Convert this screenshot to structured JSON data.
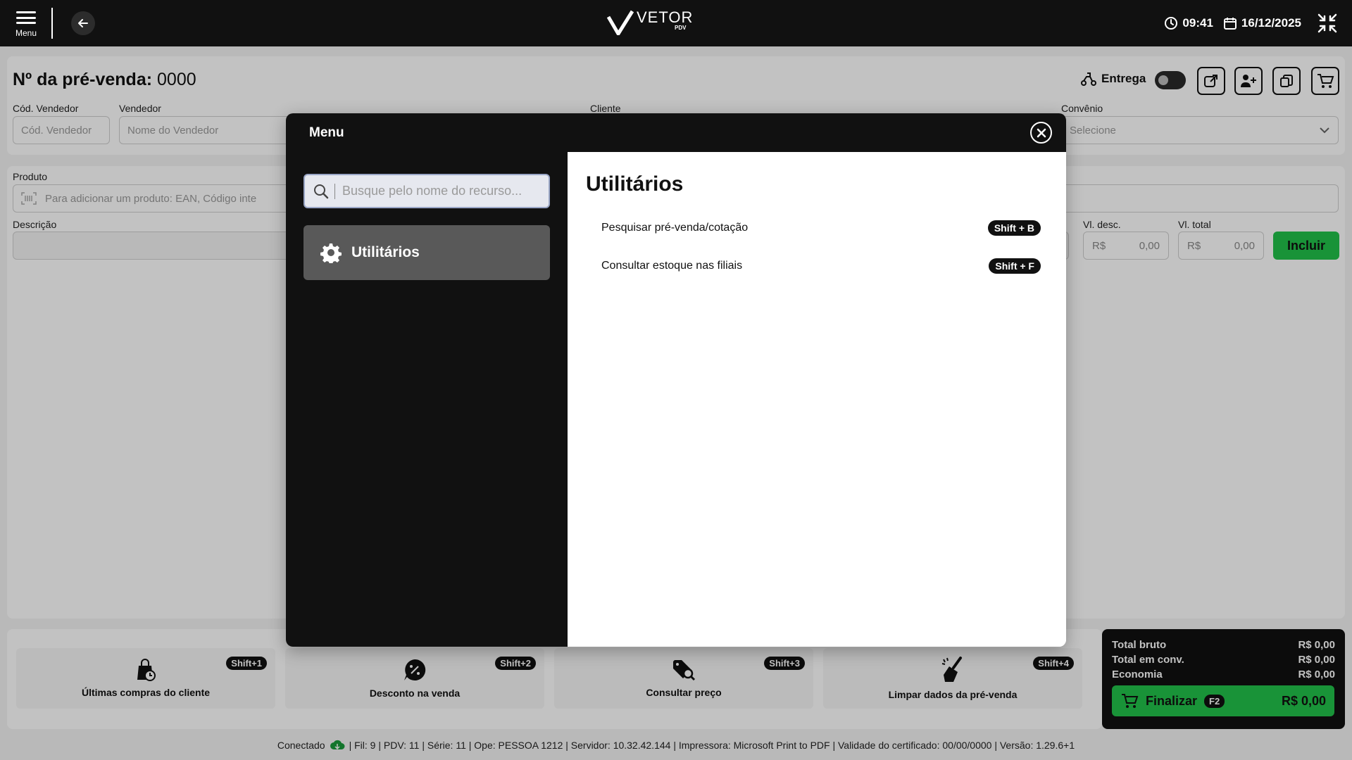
{
  "topbar": {
    "menu_label": "Menu",
    "logo_main": "VETOR",
    "logo_sub": "PDV",
    "time": "09:41",
    "date": "16/12/2025"
  },
  "presale": {
    "title": "Nº da pré-venda:",
    "number": "0000",
    "entrega_label": "Entrega"
  },
  "form": {
    "cod_vendedor_label": "Cód. Vendedor",
    "cod_vendedor_placeholder": "Cód. Vendedor",
    "vendedor_label": "Vendedor",
    "vendedor_placeholder": "Nome do Vendedor",
    "cliente_label": "Cliente",
    "convenio_label": "Convênio",
    "convenio_placeholder": "Selecione",
    "produto_label": "Produto",
    "produto_placeholder": "Para adicionar um produto: EAN, Código inte",
    "descricao_label": "Descrição",
    "vl_desc_label": "Vl. desc.",
    "vl_total_label": "Vl. total",
    "currency": "R$",
    "zero": "0,00",
    "incluir": "Incluir"
  },
  "shortcuts": [
    {
      "label": "Últimas compras do cliente",
      "key": "Shift+1"
    },
    {
      "label": "Desconto na venda",
      "key": "Shift+2"
    },
    {
      "label": "Consultar preço",
      "key": "Shift+3"
    },
    {
      "label": "Limpar dados da pré-venda",
      "key": "Shift+4"
    }
  ],
  "totals": {
    "bruto_label": "Total bruto",
    "bruto_value": "R$ 0,00",
    "conv_label": "Total em conv.",
    "conv_value": "R$ 0,00",
    "economia_label": "Economia",
    "economia_value": "R$ 0,00",
    "finalizar_label": "Finalizar",
    "finalizar_key": "F2",
    "finalizar_value": "R$ 0,00"
  },
  "status": {
    "connected": "Conectado",
    "details": "| Fil: 9 | PDV: 11 | Série: 11 | Ope: PESSOA 1212 | Servidor: 10.32.42.144 | Impressora: Microsoft Print to PDF | Validade do certificado: 00/00/0000 | Versão: 1.29.6+1"
  },
  "modal": {
    "title": "Menu",
    "search_placeholder": "Busque pelo nome do recurso...",
    "side_item": "Utilitários",
    "section_title": "Utilitários",
    "items": [
      {
        "label": "Pesquisar pré-venda/cotação",
        "key": "Shift + B"
      },
      {
        "label": "Consultar estoque nas filiais",
        "key": "Shift + F"
      }
    ]
  },
  "colors": {
    "accent_green": "#22c24a",
    "dark": "#111111",
    "side_item_bg": "#595959"
  }
}
